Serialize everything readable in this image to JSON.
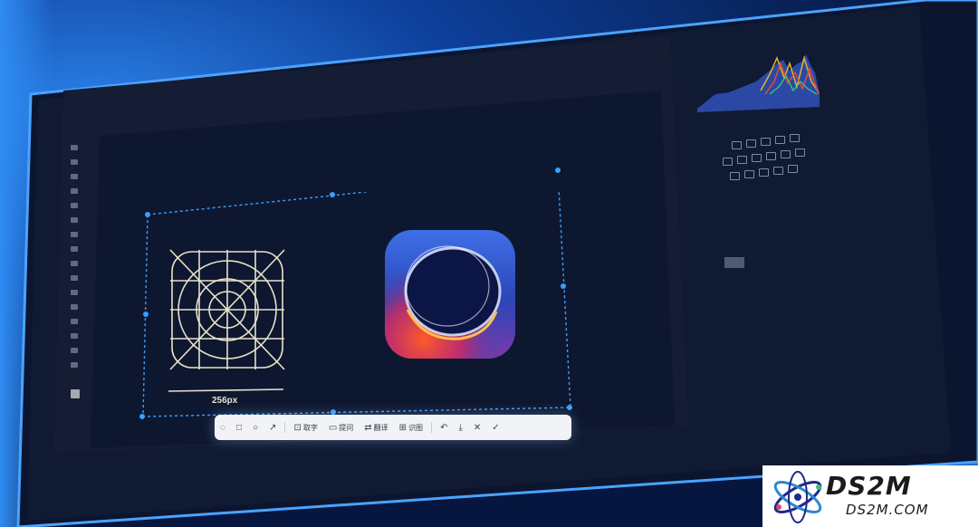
{
  "artboard": {
    "dimension_label": "256px"
  },
  "screenshot_toolbar": {
    "items": [
      {
        "icon": "lasso-icon",
        "label": ""
      },
      {
        "icon": "rectangle-icon",
        "label": ""
      },
      {
        "icon": "circle-icon",
        "label": ""
      },
      {
        "icon": "arrow-icon",
        "label": ""
      },
      {
        "icon": "text-extract-icon",
        "label": "取字"
      },
      {
        "icon": "ask-icon",
        "label": "提问"
      },
      {
        "icon": "translate-icon",
        "label": "翻译"
      },
      {
        "icon": "image-recognition-icon",
        "label": "识图"
      },
      {
        "icon": "undo-icon",
        "label": ""
      },
      {
        "icon": "download-icon",
        "label": ""
      },
      {
        "icon": "close-icon",
        "label": ""
      },
      {
        "icon": "check-icon",
        "label": ""
      }
    ]
  },
  "watermark": {
    "title": "DS2M",
    "url": "DS2M.COM"
  },
  "colors": {
    "selection": "#3aa0ff",
    "screen_glow": "#4aa3ff",
    "icon_grid_stroke": "#e8e2c8"
  }
}
